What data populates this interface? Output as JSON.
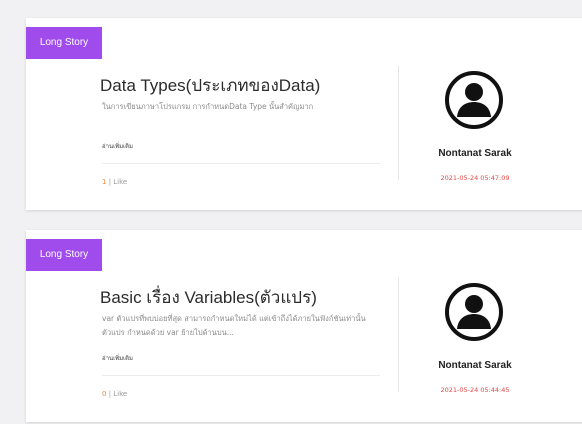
{
  "colors": {
    "tag_bg": "#a04ced",
    "date": "#e24a4a",
    "like_count": "#f08a3a"
  },
  "posts": [
    {
      "tag": "Long Story",
      "title": "Data Types(ประเภทของData)",
      "excerpt": "ในการเขียนภาษาโปรแกรม การกำหนดData Type นั้นสำคัญมาก",
      "read_more": "อ่านเพิ่มเติม",
      "like_count": "1",
      "like_label": " | Like",
      "author": "Nontanat Sarak",
      "date": "2021-05-24 05:47:09",
      "avatar_icon": "user-avatar-icon"
    },
    {
      "tag": "Long Story",
      "title": "Basic เรื่อง Variables(ตัวแปร)",
      "excerpt": "var ตัวแปรที่พบบ่อยที่สุด สามารถกำหนดใหม่ได้ แต่เข้าถึงได้ภายในฟังก์ชันเท่านั้น ตัวแปร กำหนดด้วย var ย้ายไปด้านบน...",
      "read_more": "อ่านเพิ่มเติม",
      "like_count": "0",
      "like_label": " | Like",
      "author": "Nontanat Sarak",
      "date": "2021-05-24 05:44:45",
      "avatar_icon": "user-avatar-icon"
    }
  ]
}
